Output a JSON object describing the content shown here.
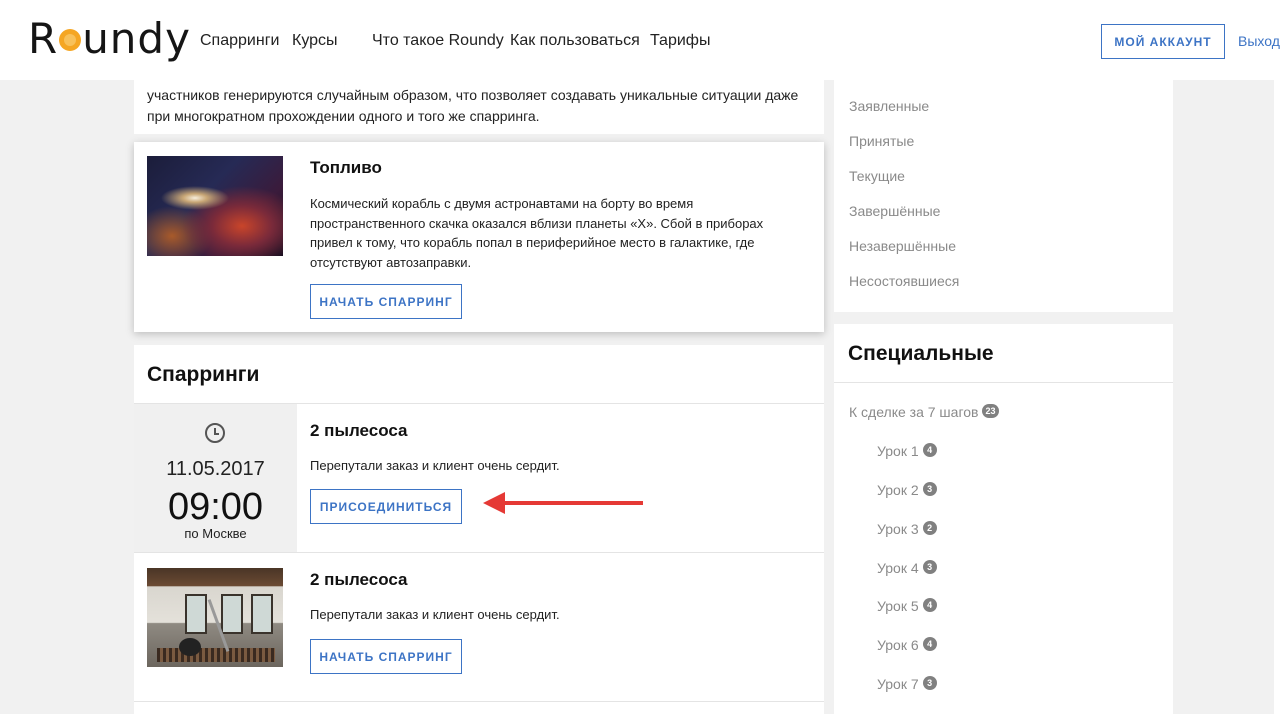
{
  "header": {
    "logo_prefix": "R",
    "logo_suffix": "undy",
    "nav": [
      "Спарринги",
      "Курсы",
      "Что такое Roundy",
      "Как пользоваться",
      "Тарифы"
    ],
    "account_button": "МОЙ АККАУНТ",
    "logout": "Выход"
  },
  "intro": {
    "text": "участников генерируются случайным образом, что позволяет создавать уникальные ситуации даже при многократном прохождении одного и того же спарринга."
  },
  "featured": {
    "title": "Топливо",
    "description": "Космический корабль с двумя астронавтами на борту во время пространственного скачка оказался вблизи планеты «Х». Сбой в приборах привел к тому, что корабль попал в периферийное место в галактике, где отсутствуют автозаправки.",
    "button": "НАЧАТЬ СПАРРИНГ"
  },
  "sparrings": {
    "heading": "Спарринги",
    "items": [
      {
        "date": "11.05.2017",
        "time": "09:00",
        "timezone": "по Москве",
        "title": "2 пылесоса",
        "description": "Перепутали заказ и клиент очень сердит.",
        "button": "ПРИСОЕДИНИТЬСЯ"
      },
      {
        "title": "2 пылесоса",
        "description": "Перепутали заказ и клиент очень сердит.",
        "button": "НАЧАТЬ СПАРРИНГ"
      }
    ]
  },
  "sidebar": {
    "statuses": [
      "Заявленные",
      "Принятые",
      "Текущие",
      "Завершённые",
      "Незавершённые",
      "Несостоявшиеся"
    ],
    "special_heading": "Специальные",
    "course": {
      "name": "К сделке за 7 шагов",
      "count": "23"
    },
    "lessons": [
      {
        "name": "Урок 1",
        "count": "4"
      },
      {
        "name": "Урок 2",
        "count": "3"
      },
      {
        "name": "Урок 3",
        "count": "2"
      },
      {
        "name": "Урок 4",
        "count": "3"
      },
      {
        "name": "Урок 5",
        "count": "4"
      },
      {
        "name": "Урок 6",
        "count": "4"
      },
      {
        "name": "Урок 7",
        "count": "3"
      }
    ]
  },
  "colors": {
    "accent": "#3d74c5",
    "arrow": "#e53935",
    "logo_dot": "#f5a623"
  }
}
